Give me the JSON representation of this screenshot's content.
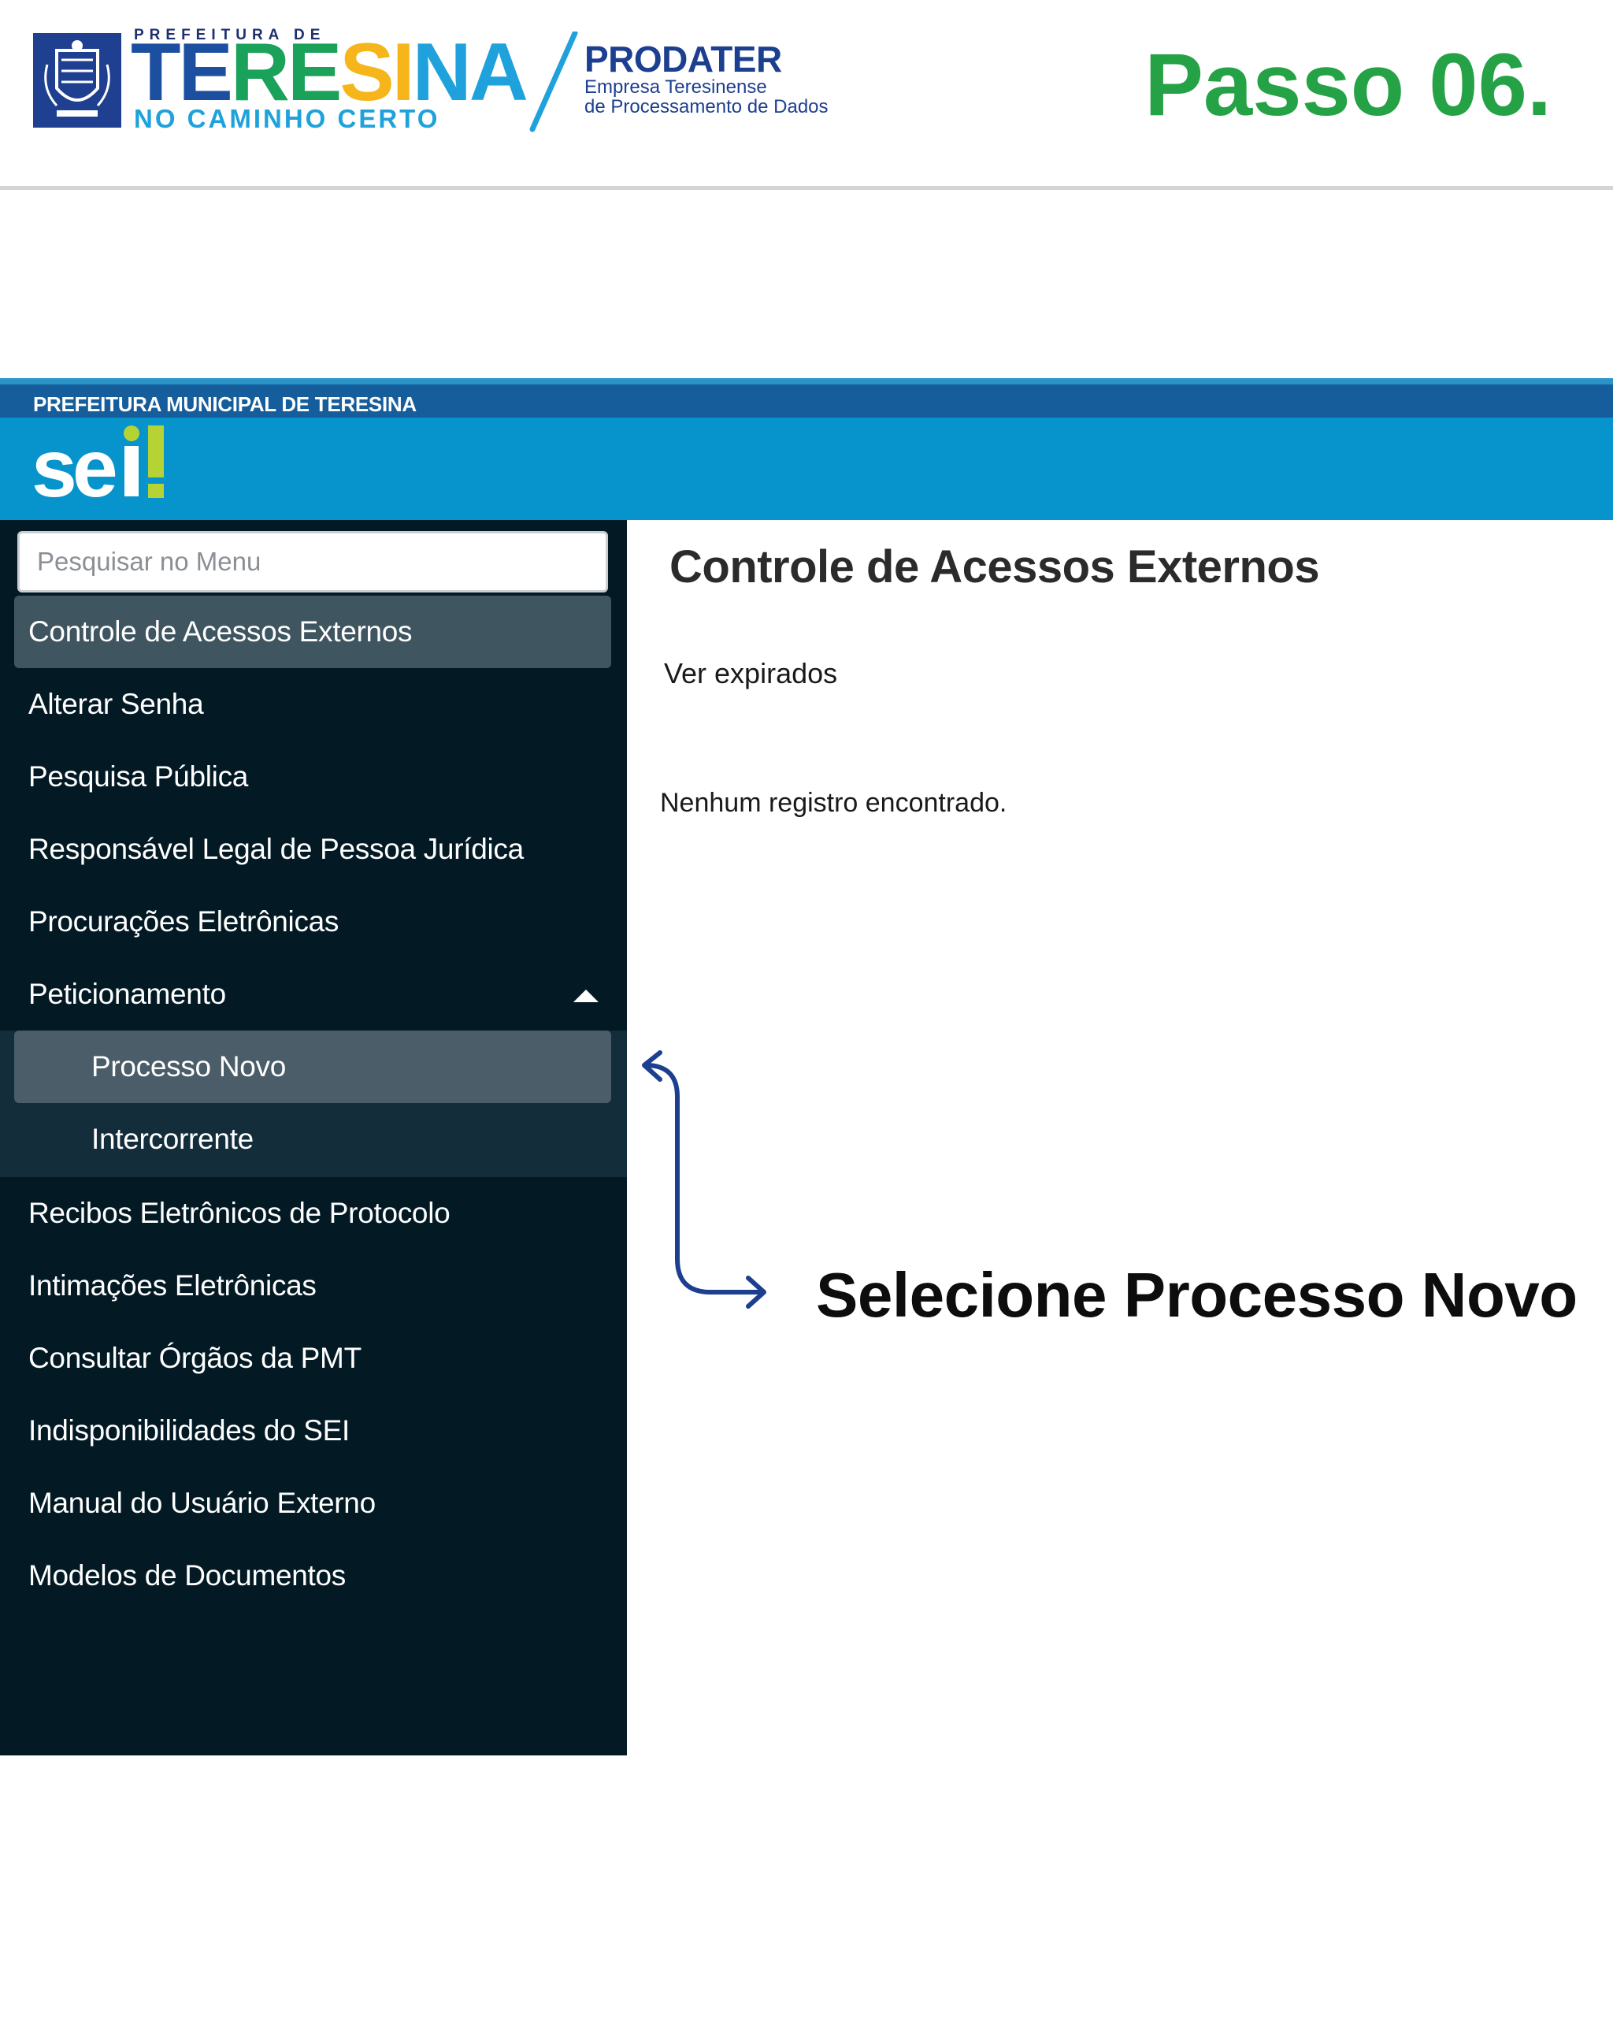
{
  "branding": {
    "prefeitura_de": "PREFEITURA DE",
    "teresina": [
      "TE",
      "RE",
      "SI",
      "NA"
    ],
    "slogan": "NO CAMINHO CERTO",
    "prodater": "PRODATER",
    "prodater_line1": "Empresa Teresinense",
    "prodater_line2": "de Processamento de Dados",
    "step": "Passo 06."
  },
  "sei": {
    "org": "PREFEITURA MUNICIPAL DE TERESINA",
    "logo": "sei",
    "search_placeholder": "Pesquisar no Menu",
    "menu": [
      "Controle de Acessos Externos",
      "Alterar Senha",
      "Pesquisa Pública",
      "Responsável Legal de Pessoa Jurídica",
      "Procurações Eletrônicas",
      "Peticionamento",
      "Recibos Eletrônicos de Protocolo",
      "Intimações Eletrônicas",
      "Consultar Órgãos da PMT",
      "Indisponibilidades do SEI",
      "Manual do Usuário Externo",
      "Modelos de Documentos"
    ],
    "submenu": [
      "Processo Novo",
      "Intercorrente"
    ],
    "content": {
      "title": "Controle de Acessos Externos",
      "link": "Ver expirados",
      "empty": "Nenhum registro encontrado."
    }
  },
  "callout": "Selecione Processo Novo",
  "colors": {
    "step_green": "#24a245",
    "sei_blue": "#0794cc",
    "sidebar": "#031a25",
    "arrow": "#1d3f8f"
  }
}
